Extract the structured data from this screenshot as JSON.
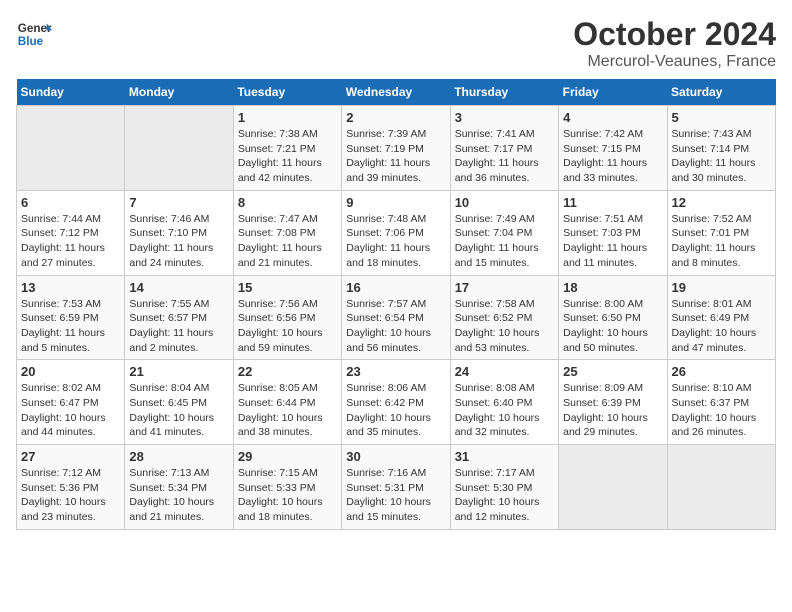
{
  "header": {
    "logo_general": "General",
    "logo_blue": "Blue",
    "title": "October 2024",
    "subtitle": "Mercurol-Veaunes, France"
  },
  "weekdays": [
    "Sunday",
    "Monday",
    "Tuesday",
    "Wednesday",
    "Thursday",
    "Friday",
    "Saturday"
  ],
  "weeks": [
    [
      {
        "day": "",
        "sunrise": "",
        "sunset": "",
        "daylight": ""
      },
      {
        "day": "",
        "sunrise": "",
        "sunset": "",
        "daylight": ""
      },
      {
        "day": "1",
        "sunrise": "Sunrise: 7:38 AM",
        "sunset": "Sunset: 7:21 PM",
        "daylight": "Daylight: 11 hours and 42 minutes."
      },
      {
        "day": "2",
        "sunrise": "Sunrise: 7:39 AM",
        "sunset": "Sunset: 7:19 PM",
        "daylight": "Daylight: 11 hours and 39 minutes."
      },
      {
        "day": "3",
        "sunrise": "Sunrise: 7:41 AM",
        "sunset": "Sunset: 7:17 PM",
        "daylight": "Daylight: 11 hours and 36 minutes."
      },
      {
        "day": "4",
        "sunrise": "Sunrise: 7:42 AM",
        "sunset": "Sunset: 7:15 PM",
        "daylight": "Daylight: 11 hours and 33 minutes."
      },
      {
        "day": "5",
        "sunrise": "Sunrise: 7:43 AM",
        "sunset": "Sunset: 7:14 PM",
        "daylight": "Daylight: 11 hours and 30 minutes."
      }
    ],
    [
      {
        "day": "6",
        "sunrise": "Sunrise: 7:44 AM",
        "sunset": "Sunset: 7:12 PM",
        "daylight": "Daylight: 11 hours and 27 minutes."
      },
      {
        "day": "7",
        "sunrise": "Sunrise: 7:46 AM",
        "sunset": "Sunset: 7:10 PM",
        "daylight": "Daylight: 11 hours and 24 minutes."
      },
      {
        "day": "8",
        "sunrise": "Sunrise: 7:47 AM",
        "sunset": "Sunset: 7:08 PM",
        "daylight": "Daylight: 11 hours and 21 minutes."
      },
      {
        "day": "9",
        "sunrise": "Sunrise: 7:48 AM",
        "sunset": "Sunset: 7:06 PM",
        "daylight": "Daylight: 11 hours and 18 minutes."
      },
      {
        "day": "10",
        "sunrise": "Sunrise: 7:49 AM",
        "sunset": "Sunset: 7:04 PM",
        "daylight": "Daylight: 11 hours and 15 minutes."
      },
      {
        "day": "11",
        "sunrise": "Sunrise: 7:51 AM",
        "sunset": "Sunset: 7:03 PM",
        "daylight": "Daylight: 11 hours and 11 minutes."
      },
      {
        "day": "12",
        "sunrise": "Sunrise: 7:52 AM",
        "sunset": "Sunset: 7:01 PM",
        "daylight": "Daylight: 11 hours and 8 minutes."
      }
    ],
    [
      {
        "day": "13",
        "sunrise": "Sunrise: 7:53 AM",
        "sunset": "Sunset: 6:59 PM",
        "daylight": "Daylight: 11 hours and 5 minutes."
      },
      {
        "day": "14",
        "sunrise": "Sunrise: 7:55 AM",
        "sunset": "Sunset: 6:57 PM",
        "daylight": "Daylight: 11 hours and 2 minutes."
      },
      {
        "day": "15",
        "sunrise": "Sunrise: 7:56 AM",
        "sunset": "Sunset: 6:56 PM",
        "daylight": "Daylight: 10 hours and 59 minutes."
      },
      {
        "day": "16",
        "sunrise": "Sunrise: 7:57 AM",
        "sunset": "Sunset: 6:54 PM",
        "daylight": "Daylight: 10 hours and 56 minutes."
      },
      {
        "day": "17",
        "sunrise": "Sunrise: 7:58 AM",
        "sunset": "Sunset: 6:52 PM",
        "daylight": "Daylight: 10 hours and 53 minutes."
      },
      {
        "day": "18",
        "sunrise": "Sunrise: 8:00 AM",
        "sunset": "Sunset: 6:50 PM",
        "daylight": "Daylight: 10 hours and 50 minutes."
      },
      {
        "day": "19",
        "sunrise": "Sunrise: 8:01 AM",
        "sunset": "Sunset: 6:49 PM",
        "daylight": "Daylight: 10 hours and 47 minutes."
      }
    ],
    [
      {
        "day": "20",
        "sunrise": "Sunrise: 8:02 AM",
        "sunset": "Sunset: 6:47 PM",
        "daylight": "Daylight: 10 hours and 44 minutes."
      },
      {
        "day": "21",
        "sunrise": "Sunrise: 8:04 AM",
        "sunset": "Sunset: 6:45 PM",
        "daylight": "Daylight: 10 hours and 41 minutes."
      },
      {
        "day": "22",
        "sunrise": "Sunrise: 8:05 AM",
        "sunset": "Sunset: 6:44 PM",
        "daylight": "Daylight: 10 hours and 38 minutes."
      },
      {
        "day": "23",
        "sunrise": "Sunrise: 8:06 AM",
        "sunset": "Sunset: 6:42 PM",
        "daylight": "Daylight: 10 hours and 35 minutes."
      },
      {
        "day": "24",
        "sunrise": "Sunrise: 8:08 AM",
        "sunset": "Sunset: 6:40 PM",
        "daylight": "Daylight: 10 hours and 32 minutes."
      },
      {
        "day": "25",
        "sunrise": "Sunrise: 8:09 AM",
        "sunset": "Sunset: 6:39 PM",
        "daylight": "Daylight: 10 hours and 29 minutes."
      },
      {
        "day": "26",
        "sunrise": "Sunrise: 8:10 AM",
        "sunset": "Sunset: 6:37 PM",
        "daylight": "Daylight: 10 hours and 26 minutes."
      }
    ],
    [
      {
        "day": "27",
        "sunrise": "Sunrise: 7:12 AM",
        "sunset": "Sunset: 5:36 PM",
        "daylight": "Daylight: 10 hours and 23 minutes."
      },
      {
        "day": "28",
        "sunrise": "Sunrise: 7:13 AM",
        "sunset": "Sunset: 5:34 PM",
        "daylight": "Daylight: 10 hours and 21 minutes."
      },
      {
        "day": "29",
        "sunrise": "Sunrise: 7:15 AM",
        "sunset": "Sunset: 5:33 PM",
        "daylight": "Daylight: 10 hours and 18 minutes."
      },
      {
        "day": "30",
        "sunrise": "Sunrise: 7:16 AM",
        "sunset": "Sunset: 5:31 PM",
        "daylight": "Daylight: 10 hours and 15 minutes."
      },
      {
        "day": "31",
        "sunrise": "Sunrise: 7:17 AM",
        "sunset": "Sunset: 5:30 PM",
        "daylight": "Daylight: 10 hours and 12 minutes."
      },
      {
        "day": "",
        "sunrise": "",
        "sunset": "",
        "daylight": ""
      },
      {
        "day": "",
        "sunrise": "",
        "sunset": "",
        "daylight": ""
      }
    ]
  ]
}
